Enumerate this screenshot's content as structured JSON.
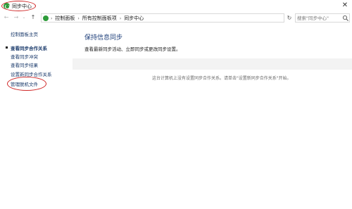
{
  "window": {
    "title": "同步中心",
    "close_label": "✕",
    "icon": "sync-center-icon"
  },
  "address_bar": {
    "back_icon": "back-arrow-icon",
    "forward_icon": "forward-arrow-icon",
    "up_icon": "up-arrow-icon",
    "breadcrumbs": [
      "控制面板",
      "所有控制面板项",
      "同步中心"
    ],
    "search_placeholder": "搜索\"同步中心\""
  },
  "sidebar": {
    "home_label": "控制面板主页",
    "items": [
      {
        "label": "查看同步合作关系",
        "selected": true
      },
      {
        "label": "查看同步冲突"
      },
      {
        "label": "查看同步结果"
      },
      {
        "label": "设置新同步合作关系"
      },
      {
        "label": "管理脱机文件"
      }
    ]
  },
  "main": {
    "title": "保持信息同步",
    "description": "查看最新同步活动、立即同步或更改同步设置。",
    "empty_message": "这台计算机上没有设置同步合作关系。请单击\"设置新同步合作关系\"开始。"
  },
  "colors": {
    "annotation_red": "#d02828",
    "sync_green": "#2e9b3a",
    "link_blue": "#1a3a6b"
  }
}
